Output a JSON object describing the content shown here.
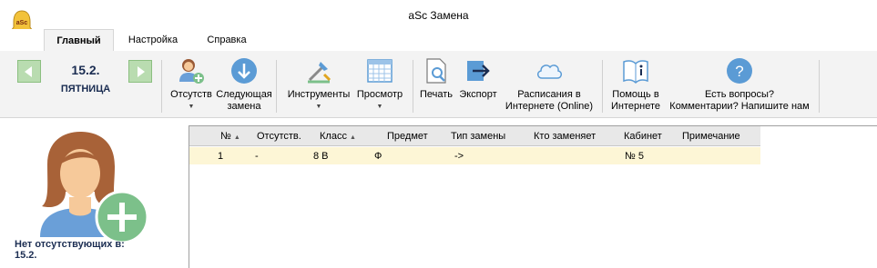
{
  "window": {
    "title": "aSc Замена",
    "app_icon": "bell-icon"
  },
  "tabs": [
    {
      "label": "Главный",
      "active": true
    },
    {
      "label": "Настройка",
      "active": false
    },
    {
      "label": "Справка",
      "active": false
    }
  ],
  "date_nav": {
    "prev_icon": "arrow-left-icon",
    "next_icon": "arrow-right-icon",
    "date": "15.2.",
    "weekday": "ПЯТНИЦА"
  },
  "ribbon": {
    "absent": {
      "label": "Отсутств",
      "icon": "person-add-icon"
    },
    "next_sub": {
      "label_line1": "Следующая",
      "label_line2": "замена",
      "icon": "arrow-down-circle-icon"
    },
    "tools": {
      "label": "Инструменты",
      "icon": "tools-icon"
    },
    "view": {
      "label": "Просмотр",
      "icon": "table-grid-icon"
    },
    "print": {
      "label": "Печать",
      "icon": "print-preview-icon"
    },
    "export": {
      "label": "Экспорт",
      "icon": "export-arrow-icon"
    },
    "online": {
      "label_line1": "Расписания в",
      "label_line2": "Интернете (Online)",
      "icon": "cloud-icon"
    },
    "help": {
      "label_line1": "Помощь в",
      "label_line2": "Интернете",
      "icon": "book-info-icon"
    },
    "questions": {
      "label_line1": "Есть вопросы?",
      "label_line2": "Комментарии? Напишите нам",
      "icon": "question-circle-icon"
    }
  },
  "left_panel": {
    "avatar_icon": "person-add-large-icon",
    "no_absent_line1": "Нет отсутствующих в:",
    "no_absent_line2": "15.2."
  },
  "grid": {
    "columns": [
      "№",
      "Отсутств.",
      "Класс",
      "Предмет",
      "Тип замены",
      "Кто заменяет",
      "Кабинет",
      "Примечание"
    ],
    "rows": [
      [
        "1",
        "-",
        "8 В",
        "Ф",
        "->",
        "",
        "№ 5",
        ""
      ]
    ]
  },
  "colors": {
    "ribbon_bg": "#f3f3f3",
    "nav_green": "#b9dcb0",
    "date_text": "#1b2d52",
    "row_highlight": "#fdf6d6",
    "header_bg": "#e8e8e8"
  }
}
